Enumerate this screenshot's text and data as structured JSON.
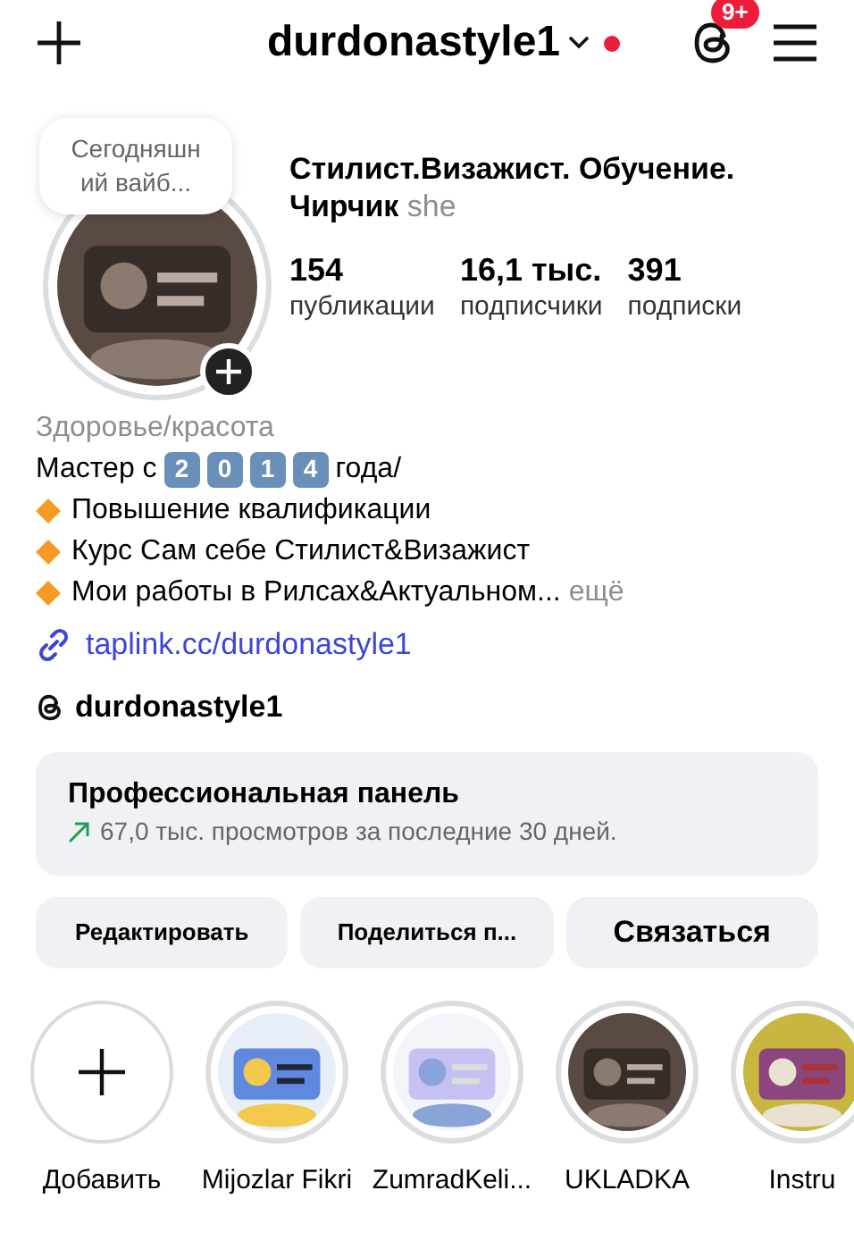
{
  "header": {
    "username": "durdonastyle1",
    "has_new_dot": true,
    "badge": "9+"
  },
  "note": "Сегодняшн ий вайб...",
  "profile": {
    "name": "Стилист.Визажист. Обучение. Чирчик",
    "pronouns": "she"
  },
  "stats": [
    {
      "value": "154",
      "label": "публикации"
    },
    {
      "value": "16,1 тыс.",
      "label": "подписчики"
    },
    {
      "value": "391",
      "label": "подписки"
    }
  ],
  "category": "Здоровье/красота",
  "bio": {
    "prefix": "Мастер с",
    "digits": [
      "2",
      "0",
      "1",
      "4"
    ],
    "suffix": "года/",
    "lines": [
      "Повышение квалификации",
      "Курс Сам себе Стилист&Визажист",
      "Мои работы в Рилсах&Актуальном..."
    ],
    "more": "ещё"
  },
  "link": "taplink.cc/durdonastyle1",
  "threads_handle": "durdonastyle1",
  "pro_panel": {
    "title": "Профессиональная панель",
    "subtitle": "67,0 тыс. просмотров за последние 30 дней."
  },
  "buttons": [
    {
      "label": "Редактировать",
      "kind": "small"
    },
    {
      "label": "Поделиться п...",
      "kind": "small"
    },
    {
      "label": "Связаться",
      "kind": "large"
    }
  ],
  "highlights": [
    {
      "label": "Добавить",
      "kind": "add"
    },
    {
      "label": "Mijozlar Fikri",
      "kind": "picture"
    },
    {
      "label": "ZumradKeli...",
      "kind": "picture"
    },
    {
      "label": "UKLADKA",
      "kind": "picture"
    },
    {
      "label": "Instru",
      "kind": "picture"
    }
  ]
}
